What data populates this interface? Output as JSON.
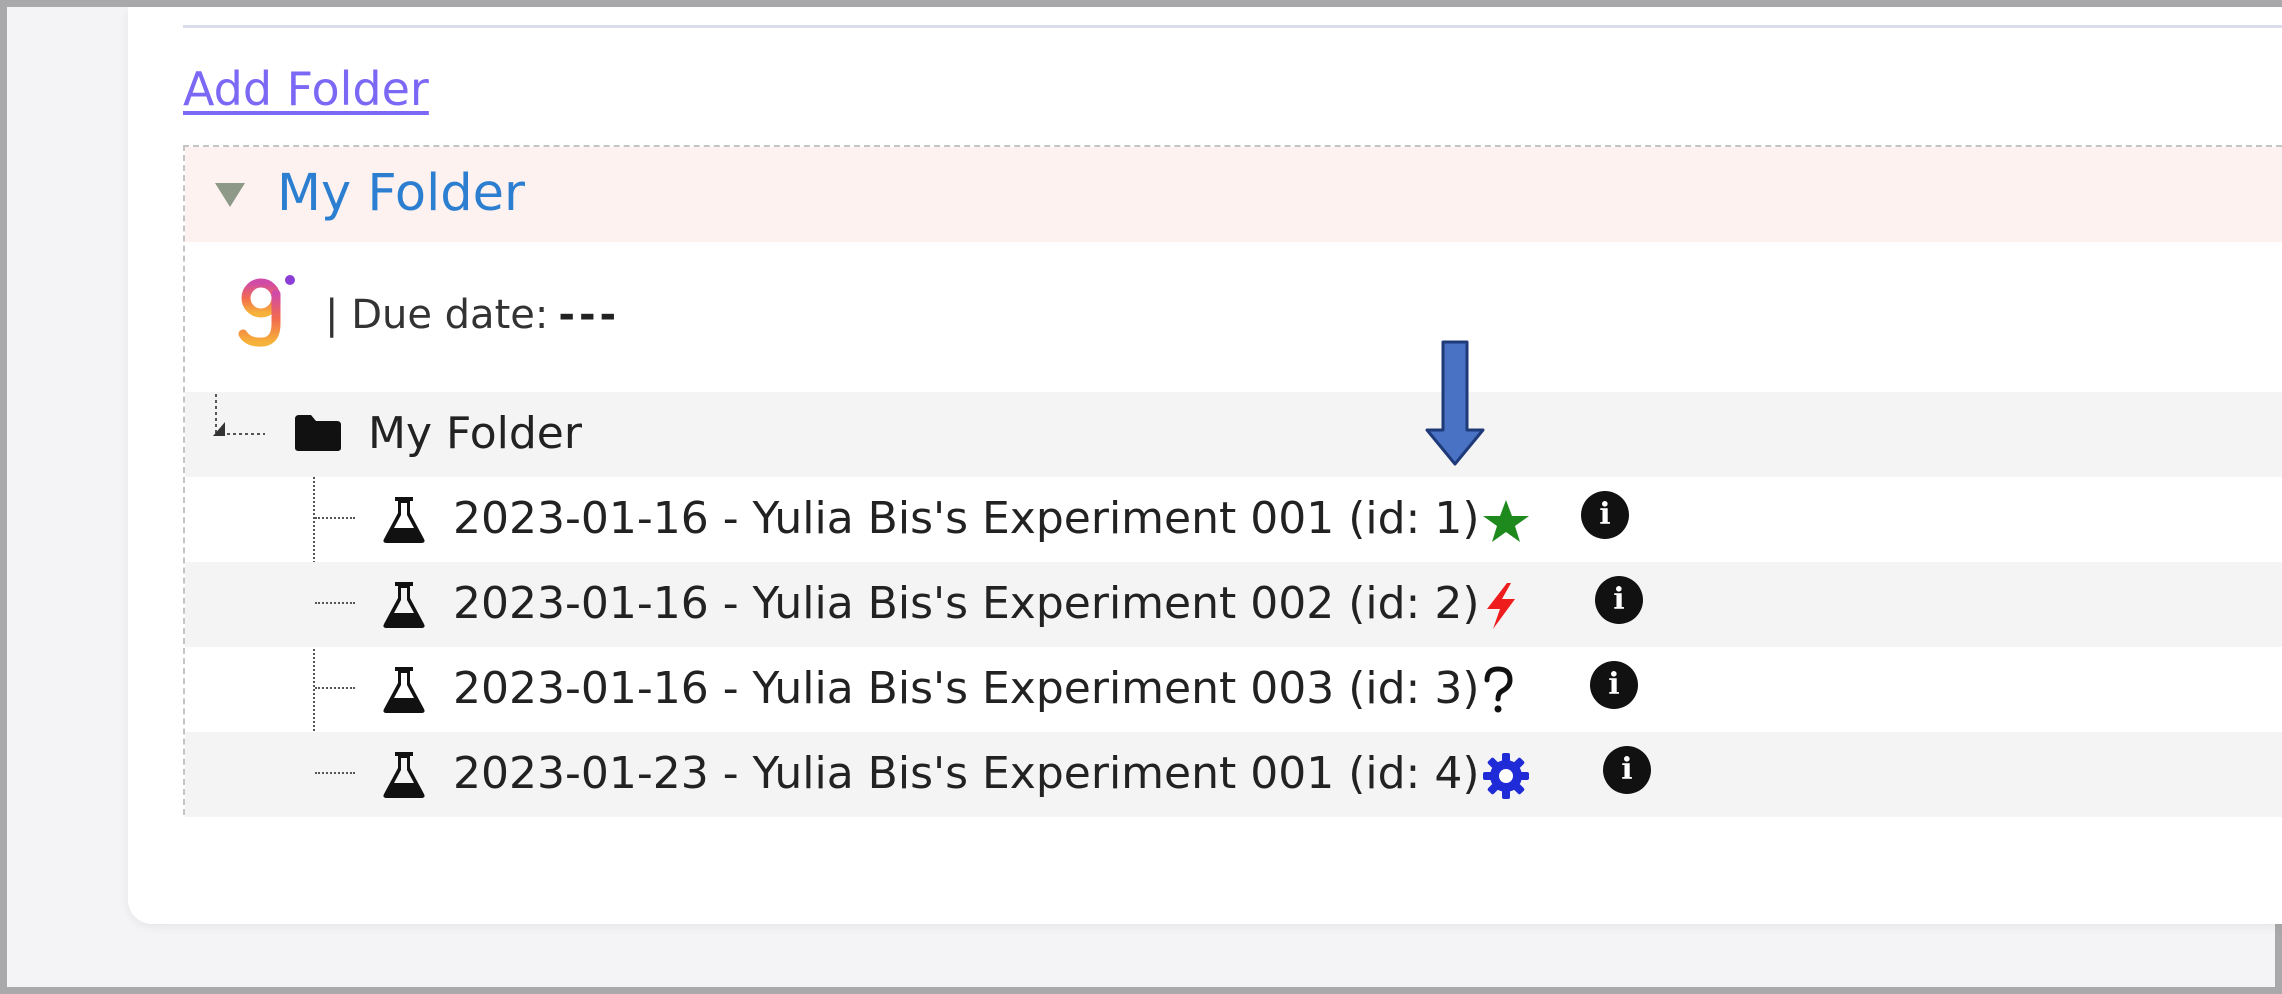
{
  "add_folder_link": "Add Folder",
  "folder": {
    "title": "My Folder",
    "due_date_label": "| Due date:",
    "due_date_value": "---",
    "tree_root_label": "My Folder",
    "experiments": [
      {
        "label": "2023-01-16 - Yulia Bis's Experiment 001 (id: 1)",
        "status_icon": "star-icon",
        "status_color": "#1e8a1e"
      },
      {
        "label": "2023-01-16 - Yulia Bis's Experiment 002 (id: 2)",
        "status_icon": "lightning-icon",
        "status_color": "#ee1c1c"
      },
      {
        "label": "2023-01-16 - Yulia Bis's Experiment 003 (id: 3)",
        "status_icon": "question-icon",
        "status_color": "#111111"
      },
      {
        "label": "2023-01-23 - Yulia Bis's Experiment 001 (id: 4)",
        "status_icon": "gear-icon",
        "status_color": "#1e2bd6"
      }
    ]
  },
  "colors": {
    "link": "#7b68f5",
    "folder_title": "#2c7fd0",
    "folder_header_bg": "#fdf2ef",
    "annotation_arrow": "#4a72c4"
  }
}
